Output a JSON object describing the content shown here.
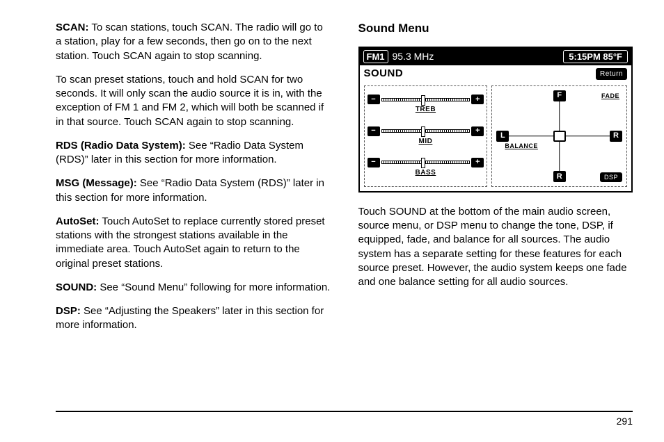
{
  "page_number": "291",
  "left": {
    "scan_label": "SCAN:",
    "scan_text": " To scan stations, touch SCAN. The radio will go to a station, play for a few seconds, then go on to the next station. Touch SCAN again to stop scanning.",
    "scan_preset": "To scan preset stations, touch and hold SCAN for two seconds. It will only scan the audio source it is in, with the exception of FM 1 and FM 2, which will both be scanned if in that source. Touch SCAN again to stop scanning.",
    "rds_label": "RDS (Radio Data System):",
    "rds_text": " See “Radio Data System (RDS)” later in this section for more information.",
    "msg_label": "MSG (Message):",
    "msg_text": " See “Radio Data System (RDS)” later in this section for more information.",
    "autoset_label": "AutoSet:",
    "autoset_text": " Touch AutoSet to replace currently stored preset stations with the strongest stations available in the immediate area. Touch AutoSet again to return to the original preset stations.",
    "sound_label": "SOUND:",
    "sound_text": " See “Sound Menu” following for more information.",
    "dsp_label": "DSP:",
    "dsp_text": " See “Adjusting the Speakers” later in this section for more information."
  },
  "right": {
    "heading": "Sound Menu",
    "body": "Touch SOUND at the bottom of the main audio screen, source menu, or DSP menu to change the tone, DSP, if equipped, fade, and balance for all sources. The audio system has a separate setting for these features for each source preset. However, the audio system keeps one fade and one balance setting for all audio sources."
  },
  "radio": {
    "band": "FM1",
    "freq": "95.3 MHz",
    "clock": "5:15PM 85°F",
    "sound_label": "SOUND",
    "return_label": "Return",
    "sliders": {
      "minus": "−",
      "plus": "+",
      "treb": "TREB",
      "mid": "MID",
      "bass": "BASS"
    },
    "balance": {
      "F": "F",
      "R_bottom": "R",
      "L": "L",
      "R_right": "R",
      "fade_label": "FADE",
      "balance_label": "BALANCE",
      "dsp": "DSP"
    }
  }
}
